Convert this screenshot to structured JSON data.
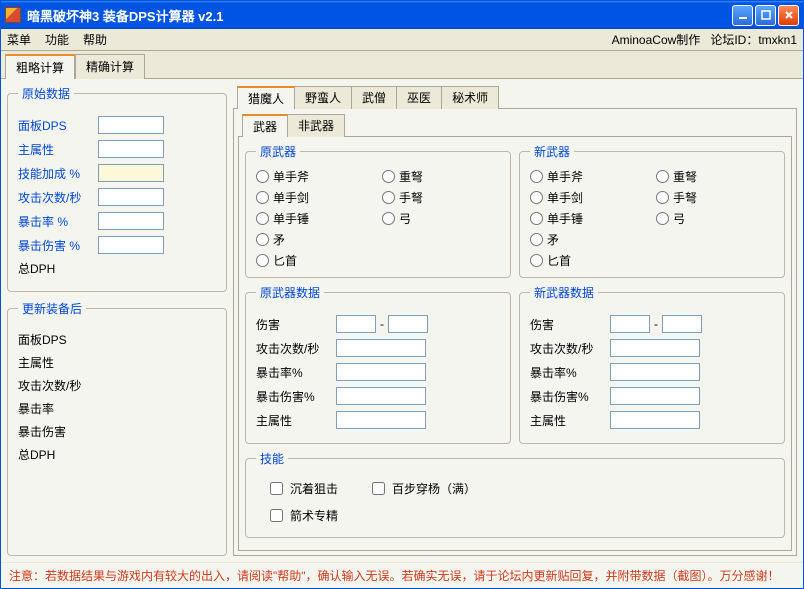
{
  "window": {
    "title": "暗黑破坏神3 装备DPS计算器  v2.1"
  },
  "menubar": {
    "menu1": "菜单",
    "menu2": "功能",
    "menu3": "帮助",
    "author": "AminoaCow制作",
    "forum": "论坛ID：tmxkn1"
  },
  "mainTabs": {
    "tab1": "粗略计算",
    "tab2": "精确计算"
  },
  "original": {
    "legend": "原始数据",
    "panelDPS": "面板DPS",
    "mainStat": "主属性",
    "skillBonus": "技能加成 %",
    "attacksPerSec": "攻击次数/秒",
    "critRate": "暴击率 %",
    "critDmg": "暴击伤害 %",
    "totalDPH": "总DPH"
  },
  "afterGear": {
    "legend": "更新装备后",
    "panelDPS": "面板DPS",
    "mainStat": "主属性",
    "attacksPerSec": "攻击次数/秒",
    "critRate": "暴击率",
    "critDmg": "暴击伤害",
    "totalDPH": "总DPH"
  },
  "classTabs": {
    "t1": "猎魔人",
    "t2": "野蛮人",
    "t3": "武僧",
    "t4": "巫医",
    "t5": "秘术师"
  },
  "wepTabs": {
    "t1": "武器",
    "t2": "非武器"
  },
  "oldWeapon": {
    "legend": "原武器",
    "r1": "单手斧",
    "r2": "重弩",
    "r3": "单手剑",
    "r4": "手弩",
    "r5": "单手锤",
    "r6": "弓",
    "r7": "矛",
    "r8": "匕首"
  },
  "newWeapon": {
    "legend": "新武器",
    "r1": "单手斧",
    "r2": "重弩",
    "r3": "单手剑",
    "r4": "手弩",
    "r5": "单手锤",
    "r6": "弓",
    "r7": "矛",
    "r8": "匕首"
  },
  "oldData": {
    "legend": "原武器数据",
    "dmg": "伤害",
    "aps": "攻击次数/秒",
    "crit": "暴击率%",
    "critd": "暴击伤害%",
    "main": "主属性",
    "sep": "-"
  },
  "newData": {
    "legend": "新武器数据",
    "dmg": "伤害",
    "aps": "攻击次数/秒",
    "crit": "暴击率%",
    "critd": "暴击伤害%",
    "main": "主属性",
    "sep": "-"
  },
  "skills": {
    "legend": "技能",
    "s1": "沉着狙击",
    "s2": "百步穿杨（满）",
    "s3": "箭术专精"
  },
  "footerNote": "注意：若数据结果与游戏内有较大的出入，请阅读\"帮助\"，确认输入无误。若确实无误，请于论坛内更新贴回复，并附带数据（截图）。万分感谢！"
}
